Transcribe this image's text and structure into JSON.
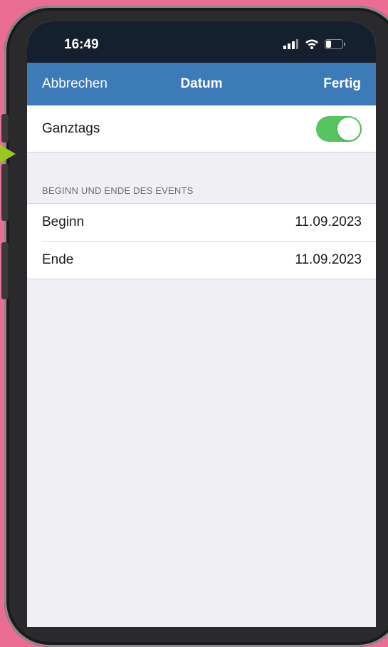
{
  "status": {
    "time": "16:49"
  },
  "nav": {
    "cancel": "Abbrechen",
    "title": "Datum",
    "done": "Fertig"
  },
  "allday": {
    "label": "Ganztags",
    "on": true
  },
  "section": {
    "header": "BEGINN UND ENDE DES EVENTS",
    "rows": [
      {
        "label": "Beginn",
        "value": "11.09.2023"
      },
      {
        "label": "Ende",
        "value": "11.09.2023"
      }
    ]
  },
  "colors": {
    "nav": "#3d7ab8",
    "toggle": "#58c461",
    "background": "#ea6d93",
    "arrow": "#9bc424"
  },
  "icons": {
    "signal": "cellular-signal-icon",
    "wifi": "wifi-icon",
    "battery": "battery-icon"
  }
}
